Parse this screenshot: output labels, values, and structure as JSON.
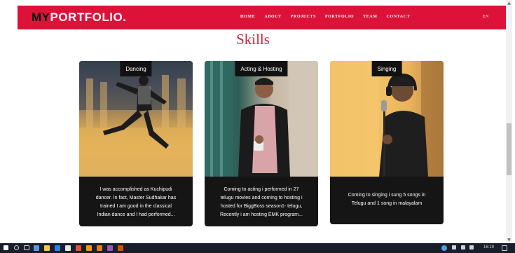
{
  "brand": {
    "part1": "MY",
    "part2": "PORTFOLIO."
  },
  "nav": [
    "HOME",
    "ABOUT",
    "PROJECTS",
    "PORTFOLIO",
    "TEAM",
    "CONTACT"
  ],
  "lang": "EN",
  "section_title": "Skills",
  "cards": [
    {
      "label": "Dancing",
      "lines": [
        "I was accomplished as Kuchipudi",
        "dancer. In fact, Master Sudhakar has",
        "trained I am good in the classical",
        "Indian dance and I had performed..."
      ]
    },
    {
      "label": "Acting & Hosting",
      "lines": [
        "Coming to acting i performed in 27",
        "telugu movies and coming to hosting i",
        "hosted for BiggBoss season1- telugu,",
        "Recently i am hosting EMK program..."
      ]
    },
    {
      "label": "Singing",
      "lines": [
        "Coming to singing i sung 5 songs in",
        "Telugu and 1 song in malayalam"
      ]
    }
  ],
  "taskbar": {
    "clock": "16:19"
  },
  "colors": {
    "navbar": "#dc1239",
    "title": "#cf1e3c",
    "card": "#151515"
  }
}
